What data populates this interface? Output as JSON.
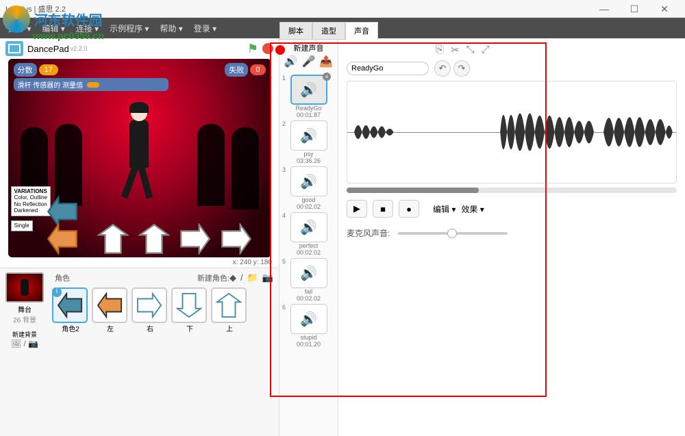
{
  "window": {
    "title": "Labplus | 盛思 2.2",
    "min": "—",
    "max": "☐",
    "close": "✕"
  },
  "watermark": {
    "text": "河东软件园",
    "url": "www.pc0359.cn"
  },
  "menu": {
    "items": [
      "文件 ▾",
      "编辑 ▾",
      "连接 ▾",
      "示例程序 ▾",
      "帮助 ▾",
      "登录 ▾"
    ]
  },
  "stage": {
    "title": "DancePad",
    "version": "v2.2.0",
    "score_label": "分数",
    "score_value": "17",
    "miss_label": "失败",
    "miss_value": "0",
    "sensor_label": "滑杆 传感器的 测量值",
    "variations_title": "VARIATIONS",
    "variations_lines": [
      "Color, Outline",
      "No Reflection",
      "Darkened"
    ],
    "variations_single": "Single",
    "coords": "x: 240 y: 180"
  },
  "sprites": {
    "header_label": "角色",
    "new_label": "新建角色:",
    "stage_label": "舞台",
    "stage_sub": "26 背景",
    "new_bg": "新建背景",
    "items": [
      {
        "name": "角色2",
        "type": "left",
        "color": "#4a8ca5",
        "selected": true
      },
      {
        "name": "左",
        "type": "left",
        "color": "#e8924a"
      },
      {
        "name": "右",
        "type": "right",
        "color": "#fff"
      },
      {
        "name": "下",
        "type": "down",
        "color": "#fff"
      },
      {
        "name": "上",
        "type": "up",
        "color": "#fff"
      }
    ]
  },
  "tabs": {
    "items": [
      "脚本",
      "造型",
      "声音"
    ],
    "active": 2
  },
  "sounds": {
    "new_label": "新建声音",
    "items": [
      {
        "n": "1",
        "name": "ReadyGo",
        "dur": "00:01.87",
        "selected": true
      },
      {
        "n": "2",
        "name": "psy",
        "dur": "03:36.26"
      },
      {
        "n": "3",
        "name": "good",
        "dur": "00:02.02"
      },
      {
        "n": "4",
        "name": "perfect",
        "dur": "00:02.02"
      },
      {
        "n": "5",
        "name": "fail",
        "dur": "00:02.02"
      },
      {
        "n": "6",
        "name": "stupid",
        "dur": "00:01.20"
      }
    ]
  },
  "editor": {
    "name_value": "ReadyGo",
    "edit_label": "编辑 ▾",
    "effects_label": "效果 ▾",
    "mic_label": "麦克风声音:"
  }
}
